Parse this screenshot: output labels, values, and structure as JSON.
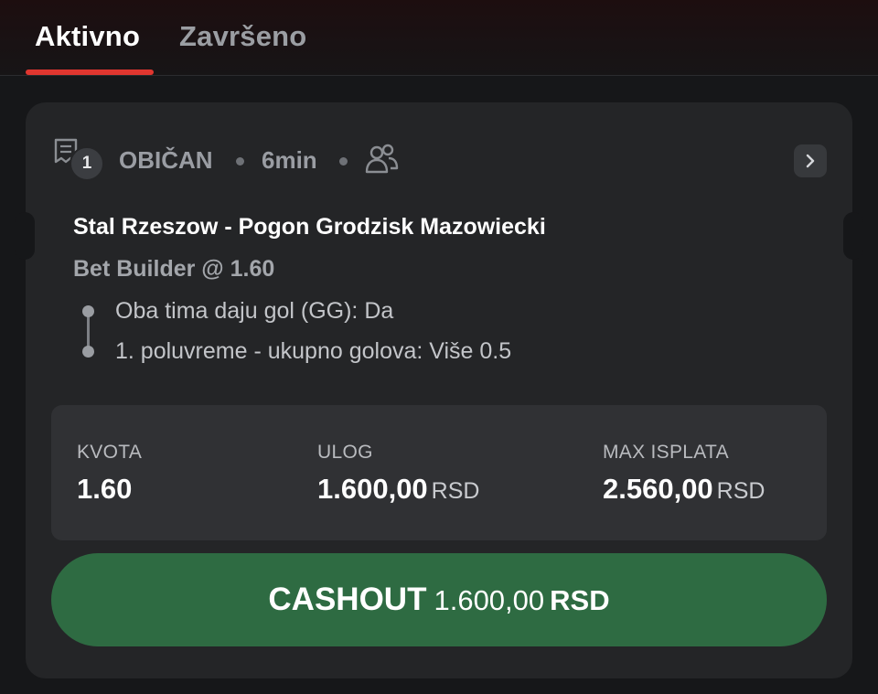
{
  "tabs": {
    "active": "Aktivno",
    "finished": "Završeno"
  },
  "ticket": {
    "selections_count": "1",
    "bet_type": "OBIČAN",
    "time_ago": "6min",
    "match": "Stal Rzeszow - Pogon Grodzisk Mazowiecki",
    "market": "Bet Builder @ 1.60",
    "selections": [
      "Oba tima daju gol (GG): Da",
      "1. poluvreme - ukupno golova: Više 0.5"
    ]
  },
  "stats": {
    "odds_label": "KVOTA",
    "odds_value": "1.60",
    "stake_label": "ULOG",
    "stake_value": "1.600,00",
    "stake_currency": "RSD",
    "max_payout_label": "MAX ISPLATA",
    "max_payout_value": "2.560,00",
    "max_payout_currency": "RSD"
  },
  "cashout": {
    "label": "CASHOUT",
    "amount": "1.600,00",
    "currency": "RSD"
  },
  "colors": {
    "accent_red": "#e0362f",
    "cashout_green": "#2e6b42"
  }
}
